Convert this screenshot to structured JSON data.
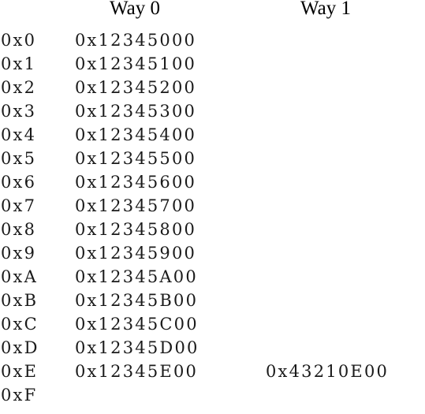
{
  "headers": {
    "way0": "Way 0",
    "way1": "Way 1"
  },
  "rows": [
    {
      "index": "0x0",
      "way0": "0x12345000",
      "way1": ""
    },
    {
      "index": "0x1",
      "way0": "0x12345100",
      "way1": ""
    },
    {
      "index": "0x2",
      "way0": "0x12345200",
      "way1": ""
    },
    {
      "index": "0x3",
      "way0": "0x12345300",
      "way1": ""
    },
    {
      "index": "0x4",
      "way0": "0x12345400",
      "way1": ""
    },
    {
      "index": "0x5",
      "way0": "0x12345500",
      "way1": ""
    },
    {
      "index": "0x6",
      "way0": "0x12345600",
      "way1": ""
    },
    {
      "index": "0x7",
      "way0": "0x12345700",
      "way1": ""
    },
    {
      "index": "0x8",
      "way0": "0x12345800",
      "way1": ""
    },
    {
      "index": "0x9",
      "way0": "0x12345900",
      "way1": ""
    },
    {
      "index": "0xA",
      "way0": "0x12345A00",
      "way1": ""
    },
    {
      "index": "0xB",
      "way0": "0x12345B00",
      "way1": ""
    },
    {
      "index": "0xC",
      "way0": "0x12345C00",
      "way1": ""
    },
    {
      "index": "0xD",
      "way0": "0x12345D00",
      "way1": ""
    },
    {
      "index": "0xE",
      "way0": "0x12345E00",
      "way1": "0x43210E00"
    },
    {
      "index": "0xF",
      "way0": "",
      "way1": ""
    }
  ]
}
